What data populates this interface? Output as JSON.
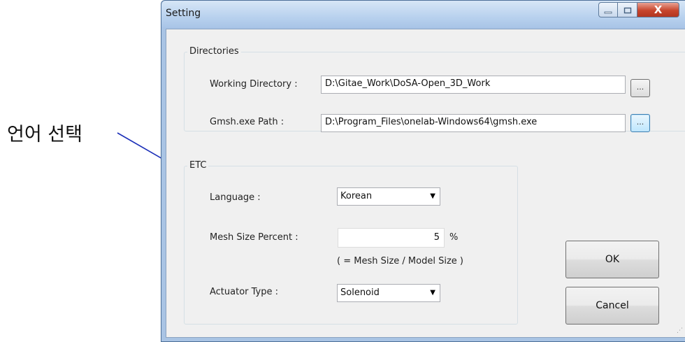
{
  "annotation": {
    "text": "언어 선택"
  },
  "window": {
    "title": "Setting",
    "controls": {
      "minimize": "–",
      "maximize": "□",
      "close": "X"
    }
  },
  "directories": {
    "title": "Directories",
    "working_dir_label": "Working Directory :",
    "working_dir_value": "D:\\Gitae_Work\\DoSA-Open_3D_Work",
    "gmsh_label": "Gmsh.exe Path :",
    "gmsh_value": "D:\\Program_Files\\onelab-Windows64\\gmsh.exe",
    "browse_label": "..."
  },
  "etc": {
    "title": "ETC",
    "language_label": "Language :",
    "language_value": "Korean",
    "mesh_label": "Mesh Size Percent :",
    "mesh_value": "5",
    "mesh_unit": "%",
    "mesh_note": "( = Mesh Size / Model Size )",
    "actuator_label": "Actuator Type :",
    "actuator_value": "Solenoid"
  },
  "buttons": {
    "ok": "OK",
    "cancel": "Cancel"
  },
  "icons": {
    "dropdown": "chevron-down-icon",
    "resize": "resize-grip-icon"
  },
  "colors": {
    "arrow": "#1b2fb8",
    "title_bar": "#b8d1ee",
    "close_button": "#c7452c"
  }
}
